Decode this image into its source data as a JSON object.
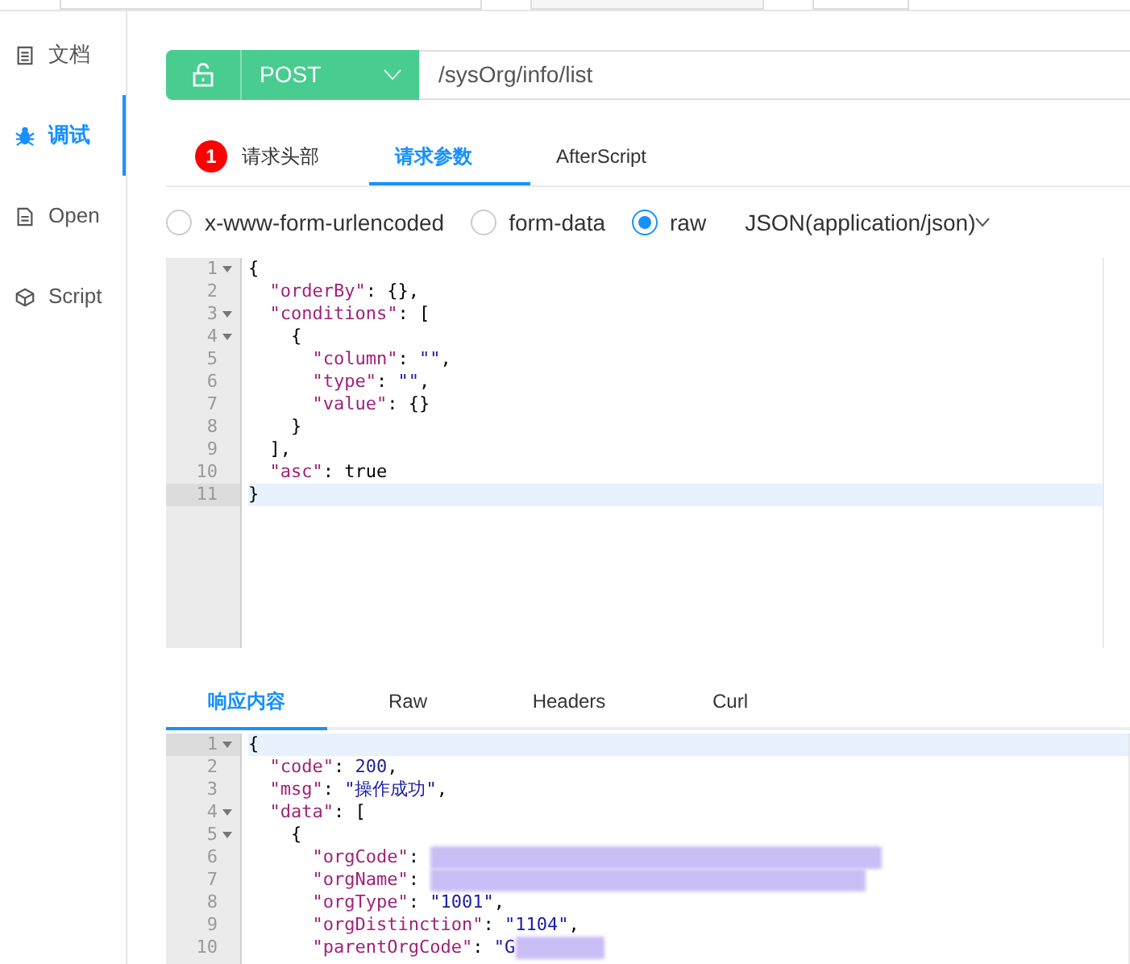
{
  "sidebar": {
    "items": [
      {
        "label": "文档",
        "selected": false
      },
      {
        "label": "调试",
        "selected": true
      },
      {
        "label": "Open",
        "selected": false
      },
      {
        "label": "Script",
        "selected": false
      }
    ]
  },
  "request": {
    "method": "POST",
    "url": "/sysOrg/info/list"
  },
  "request_tabs": [
    {
      "label": "请求头部",
      "badge": "1",
      "selected": false
    },
    {
      "label": "请求参数",
      "selected": true
    },
    {
      "label": "AfterScript",
      "selected": false
    }
  ],
  "body_types": [
    {
      "label": "x-www-form-urlencoded",
      "selected": false
    },
    {
      "label": "form-data",
      "selected": false
    },
    {
      "label": "raw",
      "selected": true
    }
  ],
  "content_type": "JSON(application/json)",
  "request_editor": [
    {
      "number": "1",
      "fold": true,
      "active": false,
      "tokens": [
        {
          "kind": "punct",
          "text": "{"
        }
      ]
    },
    {
      "number": "2",
      "fold": false,
      "active": false,
      "tokens": [
        {
          "kind": "key",
          "text": "  \"orderBy\""
        },
        {
          "kind": "punct",
          "text": ": {},"
        }
      ]
    },
    {
      "number": "3",
      "fold": true,
      "active": false,
      "tokens": [
        {
          "kind": "key",
          "text": "  \"conditions\""
        },
        {
          "kind": "punct",
          "text": ": ["
        }
      ]
    },
    {
      "number": "4",
      "fold": true,
      "active": false,
      "tokens": [
        {
          "kind": "punct",
          "text": "    {"
        }
      ]
    },
    {
      "number": "5",
      "fold": false,
      "active": false,
      "tokens": [
        {
          "kind": "key",
          "text": "      \"column\""
        },
        {
          "kind": "punct",
          "text": ": "
        },
        {
          "kind": "string",
          "text": "\"\""
        },
        {
          "kind": "punct",
          "text": ","
        }
      ]
    },
    {
      "number": "6",
      "fold": false,
      "active": false,
      "tokens": [
        {
          "kind": "key",
          "text": "      \"type\""
        },
        {
          "kind": "punct",
          "text": ": "
        },
        {
          "kind": "string",
          "text": "\"\""
        },
        {
          "kind": "punct",
          "text": ","
        }
      ]
    },
    {
      "number": "7",
      "fold": false,
      "active": false,
      "tokens": [
        {
          "kind": "key",
          "text": "      \"value\""
        },
        {
          "kind": "punct",
          "text": ": {}"
        }
      ]
    },
    {
      "number": "8",
      "fold": false,
      "active": false,
      "tokens": [
        {
          "kind": "punct",
          "text": "    }"
        }
      ]
    },
    {
      "number": "9",
      "fold": false,
      "active": false,
      "tokens": [
        {
          "kind": "punct",
          "text": "  ],"
        }
      ]
    },
    {
      "number": "10",
      "fold": false,
      "active": false,
      "tokens": [
        {
          "kind": "key",
          "text": "  \"asc\""
        },
        {
          "kind": "punct",
          "text": ": true"
        }
      ]
    },
    {
      "number": "11",
      "fold": false,
      "active": true,
      "tokens": [
        {
          "kind": "punct",
          "text": "}"
        }
      ]
    }
  ],
  "response_tabs": [
    {
      "label": "响应内容",
      "selected": true
    },
    {
      "label": "Raw",
      "selected": false
    },
    {
      "label": "Headers",
      "selected": false
    },
    {
      "label": "Curl",
      "selected": false
    }
  ],
  "response_editor": [
    {
      "number": "1",
      "fold": true,
      "active": true,
      "tokens": [
        {
          "kind": "punct",
          "text": "{"
        }
      ]
    },
    {
      "number": "2",
      "fold": false,
      "active": false,
      "tokens": [
        {
          "kind": "key",
          "text": "  \"code\""
        },
        {
          "kind": "punct",
          "text": ": "
        },
        {
          "kind": "number",
          "text": "200"
        },
        {
          "kind": "punct",
          "text": ","
        }
      ]
    },
    {
      "number": "3",
      "fold": false,
      "active": false,
      "tokens": [
        {
          "kind": "key",
          "text": "  \"msg\""
        },
        {
          "kind": "punct",
          "text": ": "
        },
        {
          "kind": "string",
          "text": "\"操作成功\""
        },
        {
          "kind": "punct",
          "text": ","
        }
      ]
    },
    {
      "number": "4",
      "fold": true,
      "active": false,
      "tokens": [
        {
          "kind": "key",
          "text": "  \"data\""
        },
        {
          "kind": "punct",
          "text": ": ["
        }
      ]
    },
    {
      "number": "5",
      "fold": true,
      "active": false,
      "tokens": [
        {
          "kind": "punct",
          "text": "    {"
        }
      ]
    },
    {
      "number": "6",
      "fold": false,
      "active": false,
      "tokens": [
        {
          "kind": "key",
          "text": "      \"orgCode\""
        },
        {
          "kind": "punct",
          "text": ": "
        },
        {
          "kind": "redacted"
        }
      ]
    },
    {
      "number": "7",
      "fold": false,
      "active": false,
      "tokens": [
        {
          "kind": "key",
          "text": "      \"orgName\""
        },
        {
          "kind": "punct",
          "text": ": "
        },
        {
          "kind": "redacted"
        }
      ]
    },
    {
      "number": "8",
      "fold": false,
      "active": false,
      "tokens": [
        {
          "kind": "key",
          "text": "      \"orgType\""
        },
        {
          "kind": "punct",
          "text": ": "
        },
        {
          "kind": "string",
          "text": "\"1001\""
        },
        {
          "kind": "punct",
          "text": ","
        }
      ]
    },
    {
      "number": "9",
      "fold": false,
      "active": false,
      "tokens": [
        {
          "kind": "key",
          "text": "      \"orgDistinction\""
        },
        {
          "kind": "punct",
          "text": ": "
        },
        {
          "kind": "string",
          "text": "\"1104\""
        },
        {
          "kind": "punct",
          "text": ","
        }
      ]
    },
    {
      "number": "10",
      "fold": false,
      "active": false,
      "tokens": [
        {
          "kind": "key",
          "text": "      \"parentOrgCode\""
        },
        {
          "kind": "punct",
          "text": ": "
        },
        {
          "kind": "string",
          "text": "\"G"
        },
        {
          "kind": "redacted"
        }
      ]
    }
  ]
}
